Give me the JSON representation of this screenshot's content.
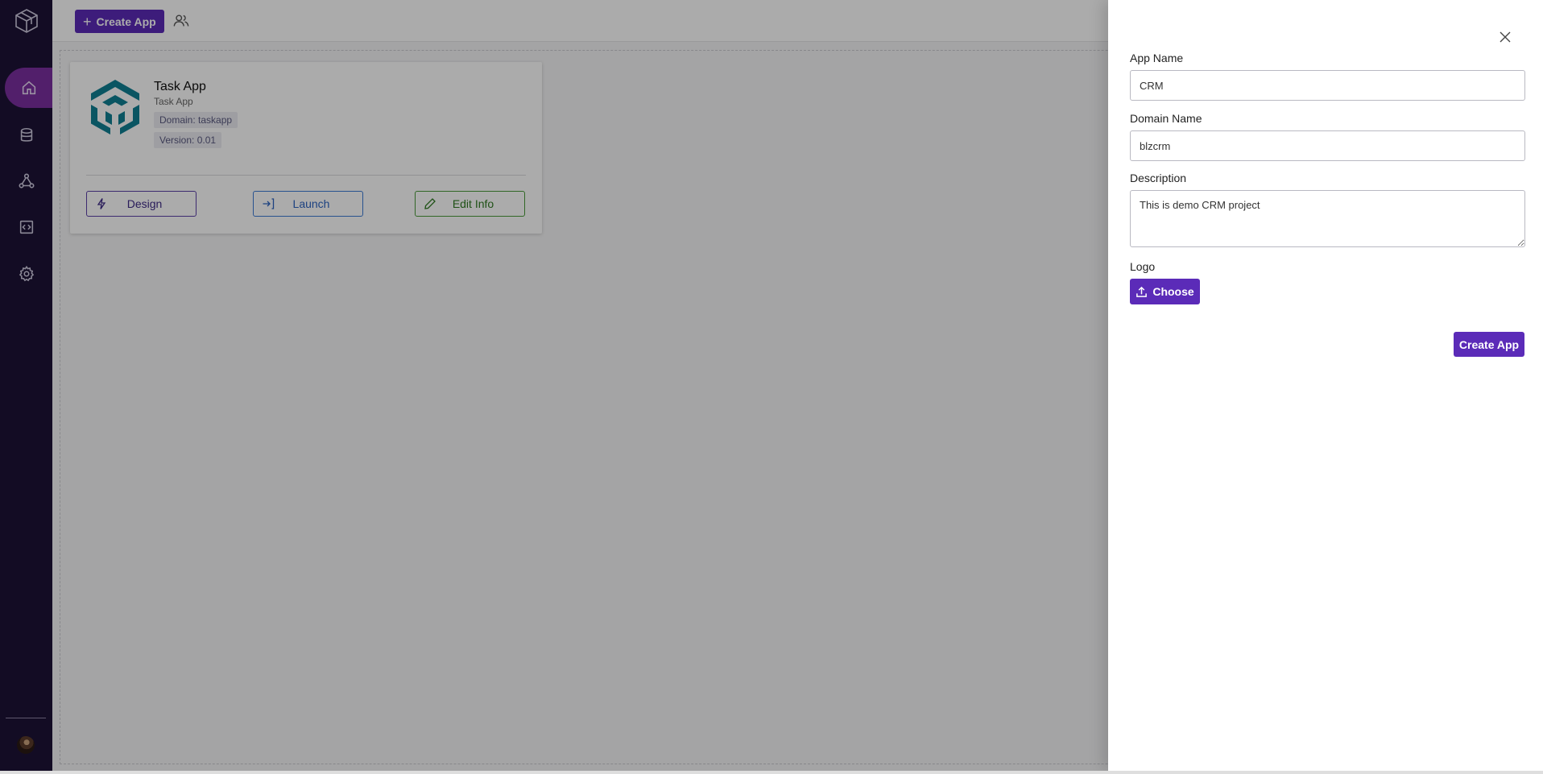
{
  "toolbar": {
    "create_app_label": "Create App"
  },
  "icons": {
    "logo": "cube-logo-icon",
    "nav": [
      "home-icon",
      "database-icon",
      "network-icon",
      "code-icon",
      "gear-icon"
    ],
    "users": "users-icon"
  },
  "app_card": {
    "title": "Task App",
    "subtitle": "Task App",
    "domain_tag": "Domain: taskapp",
    "version_tag": "Version: 0.01",
    "buttons": {
      "design": "Design",
      "launch": "Launch",
      "edit": "Edit Info"
    }
  },
  "form": {
    "app_name_label": "App Name",
    "app_name_value": "CRM",
    "domain_label": "Domain Name",
    "domain_value": "blzcrm",
    "description_label": "Description",
    "description_value": "This is demo CRM project",
    "logo_label": "Logo",
    "choose_label": "Choose",
    "submit_label": "Create App"
  },
  "colors": {
    "sidebar": "#1d1336",
    "accent": "#5b2bb8",
    "active_nav": "#7b2fa0",
    "app_logo": "#0f7f93"
  }
}
